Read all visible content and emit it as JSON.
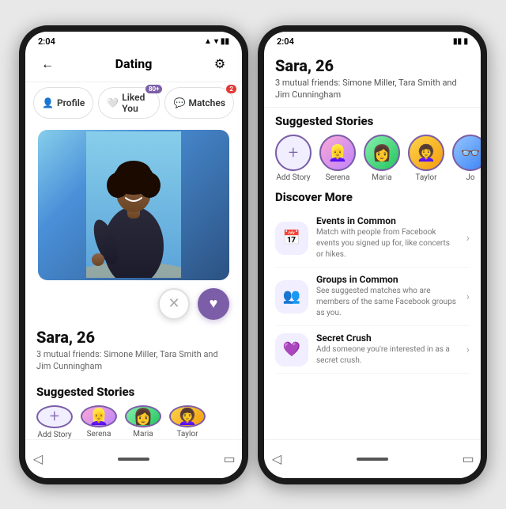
{
  "phone1": {
    "statusBar": {
      "time": "2:04",
      "icons": "▲ ◀ ■ ▮▮"
    },
    "header": {
      "backIcon": "←",
      "title": "Dating",
      "settingsIcon": "⚙"
    },
    "tabs": [
      {
        "id": "profile",
        "label": "Profile",
        "icon": "👤",
        "active": false,
        "badge": null
      },
      {
        "id": "liked-you",
        "label": "Liked You",
        "icon": "🤍",
        "active": false,
        "badge": "80+"
      },
      {
        "id": "matches",
        "label": "Matches",
        "icon": "💬",
        "active": false,
        "badge": "2"
      }
    ],
    "profile": {
      "name": "Sara, 26",
      "friends": "3 mutual friends: Simone Miller, Tara Smith and Jim Cunningham"
    },
    "actionButtons": {
      "close": "✕",
      "heart": "♥"
    },
    "suggestedStories": {
      "title": "Suggested Stories",
      "items": [
        {
          "id": "add",
          "label": "Add Story",
          "type": "add"
        },
        {
          "id": "serena",
          "label": "Serena",
          "type": "avatar"
        },
        {
          "id": "maria",
          "label": "Maria",
          "type": "avatar"
        },
        {
          "id": "taylor",
          "label": "Taylor",
          "type": "avatar"
        }
      ]
    },
    "nav": {
      "back": "◁",
      "home": "⬜",
      "square": "▭"
    }
  },
  "phone2": {
    "statusBar": {
      "time": "2:04",
      "icons": "■ ▮▮"
    },
    "profile": {
      "name": "Sara, 26",
      "friends": "3 mutual friends: Simone Miller, Tara Smith and Jim Cunningham"
    },
    "suggestedStories": {
      "title": "Suggested Stories",
      "items": [
        {
          "id": "add",
          "label": "Add Story",
          "type": "add"
        },
        {
          "id": "serena",
          "label": "Serena",
          "type": "avatar"
        },
        {
          "id": "maria",
          "label": "Maria",
          "type": "avatar"
        },
        {
          "id": "taylor",
          "label": "Taylor",
          "type": "avatar"
        },
        {
          "id": "jo",
          "label": "Jo",
          "type": "avatar"
        }
      ]
    },
    "discoverMore": {
      "title": "Discover More",
      "items": [
        {
          "id": "events",
          "icon": "📅",
          "title": "Events in Common",
          "description": "Match with people from Facebook events you signed up for, like concerts or hikes."
        },
        {
          "id": "groups",
          "icon": "👥",
          "title": "Groups in Common",
          "description": "See suggested matches who are members of the same Facebook groups as you."
        },
        {
          "id": "secret-crush",
          "icon": "💜",
          "title": "Secret Crush",
          "description": "Add someone you're interested in as a secret crush."
        }
      ]
    },
    "nav": {
      "back": "◁",
      "home": "⬜",
      "square": "▭"
    }
  },
  "colors": {
    "purple": "#7b5ea7",
    "lightPurple": "#f0eeff",
    "red": "#e53935",
    "darkBg": "#1a1a1a",
    "textDark": "#111111",
    "textMid": "#555555",
    "textLight": "#aaaaaa"
  }
}
